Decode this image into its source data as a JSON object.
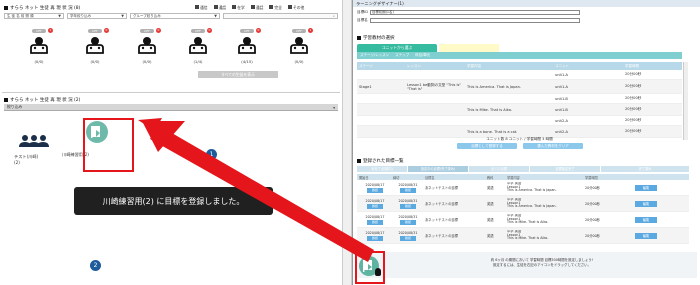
{
  "left": {
    "section1_title": "すらら ネット 生徒 再 現 状 況 (8)",
    "legend": [
      {
        "label": "通信",
        "color": "#666666"
      },
      {
        "label": "通話",
        "color": "#444444"
      },
      {
        "label": "在学",
        "color": "#666666"
      },
      {
        "label": "通話",
        "color": "#444444"
      },
      {
        "label": "完全",
        "color": "#666666"
      },
      {
        "label": "その他",
        "color": "#444444"
      }
    ],
    "filters": [
      {
        "value": "生 徒 名 前 照 順",
        "chevron": "▼"
      },
      {
        "value": "学年絞り込み",
        "chevron": "▼"
      },
      {
        "value": "グループ絞り込み",
        "chevron": "▼"
      },
      {
        "value": "",
        "chevron": ""
      }
    ],
    "students": [
      {
        "off": "OFF",
        "badge": "1",
        "ratio": "(0/0)"
      },
      {
        "off": "OFF",
        "badge": "0",
        "ratio": "(0/0)"
      },
      {
        "off": "OFF",
        "badge": "0",
        "ratio": "(0/0)"
      },
      {
        "off": "OFF",
        "badge": "0",
        "ratio": "(1/4)"
      },
      {
        "off": "OFF",
        "badge": "0",
        "ratio": "(4/15)"
      },
      {
        "off": "OFF",
        "badge": "1",
        "ratio": "(0/0)"
      }
    ],
    "show_all_label": "すべての生徒を表示",
    "section2_title": "すらら ネット 生徒 再 現 状 況 (2)",
    "group_bar_label": "絞り込み",
    "group_items": [
      {
        "name": "テスト(川崎)",
        "count": "(2)"
      },
      {
        "name": "川崎練習用(2)",
        "count": ""
      }
    ],
    "toast": "川崎練習用(2) に目標を登録しました。",
    "step1": "1",
    "step2": "2"
  },
  "right": {
    "window_title": "ラーニングデザイナー(1)",
    "label_id": "目標ID",
    "value_id": "目標初期(1名)",
    "label_name": "目標名",
    "section_header": "学習教材の選択",
    "tab_active": "ユニットから選ぶ",
    "tab_inactive": "",
    "filter_bar": [
      "ステージ/レッスン",
      "ステップ",
      "科目/単元"
    ],
    "table_headers": [
      "ステージ",
      "レッスン",
      "学習内容",
      "ユニット",
      "学習時間"
    ],
    "table_rows": [
      {
        "stage": "",
        "lesson": "",
        "content": "",
        "unit": "unit1-A",
        "time": "20分00秒"
      },
      {
        "stage": "Stage1",
        "lesson": "Lesson1 be動詞の文型 \"This is\" \"That is\"",
        "content": "This is America. That is Japan.",
        "unit": "unit1-A",
        "time": "20分00秒"
      },
      {
        "stage": "",
        "lesson": "",
        "content": "",
        "unit": "unit1-B",
        "time": "20分00秒"
      },
      {
        "stage": "",
        "lesson": "",
        "content": "This is Mike. That is Aiko.",
        "unit": "unit1-B",
        "time": "20分00秒"
      },
      {
        "stage": "",
        "lesson": "",
        "content": "",
        "unit": "unit2-A",
        "time": "20分00秒"
      },
      {
        "stage": "",
        "lesson": "",
        "content": "This is a bone. That is a cat.",
        "unit": "unit2-A",
        "time": "20分00秒"
      }
    ],
    "summary_line": "ユニット数 8 ユニット / 学習時間 3 時間",
    "add_button": "目標として登録する",
    "clear_button": "選んだ教材をクリア",
    "list_title": "登録された目標一覧",
    "list_tabs": [
      "未完了(前期中)",
      "設定中の目標(完了済み)",
      "全ての目標",
      "目標設定完了",
      "完了済み"
    ],
    "list_headers": [
      "開始日",
      "締切",
      "目標名",
      "教科",
      "学習内容",
      "学習時間",
      ""
    ],
    "list_rows": [
      {
        "start": "2020/08/17",
        "end": "2020/08/31",
        "title": "あネットテストの目標",
        "subject": "英語",
        "content": "中学 英語\nLesson1\nThis is America. That is Japan.",
        "time": "20分00秒",
        "btn": "編集"
      },
      {
        "start": "2020/08/17",
        "end": "2020/08/31",
        "title": "あネットテストの目標",
        "subject": "英語",
        "content": "中学 英語\nLesson1\nThis is America. That is Japan.",
        "time": "20分00秒",
        "btn": "編集"
      },
      {
        "start": "2020/08/17",
        "end": "2020/08/31",
        "title": "あネットテストの目標",
        "subject": "英語",
        "content": "中学 英語\nLesson1\nThis is Mike. That is Aiko.",
        "time": "20分00秒",
        "btn": "編集"
      },
      {
        "start": "2020/08/17",
        "end": "2020/08/31",
        "title": "あネットテストの目標",
        "subject": "英語",
        "content": "中学 英語\nLesson1\nThis is Mike. That is Aiko.",
        "time": "20分00秒",
        "btn": "編集"
      }
    ],
    "row_small_btn": "確認",
    "footer_line1": "約 6ヶ月 の期間において 学習時間 目標300時間を設定しましょう!",
    "footer_line2": "設定するには、生徒を右記のアイコンをドラッグしてください。"
  }
}
